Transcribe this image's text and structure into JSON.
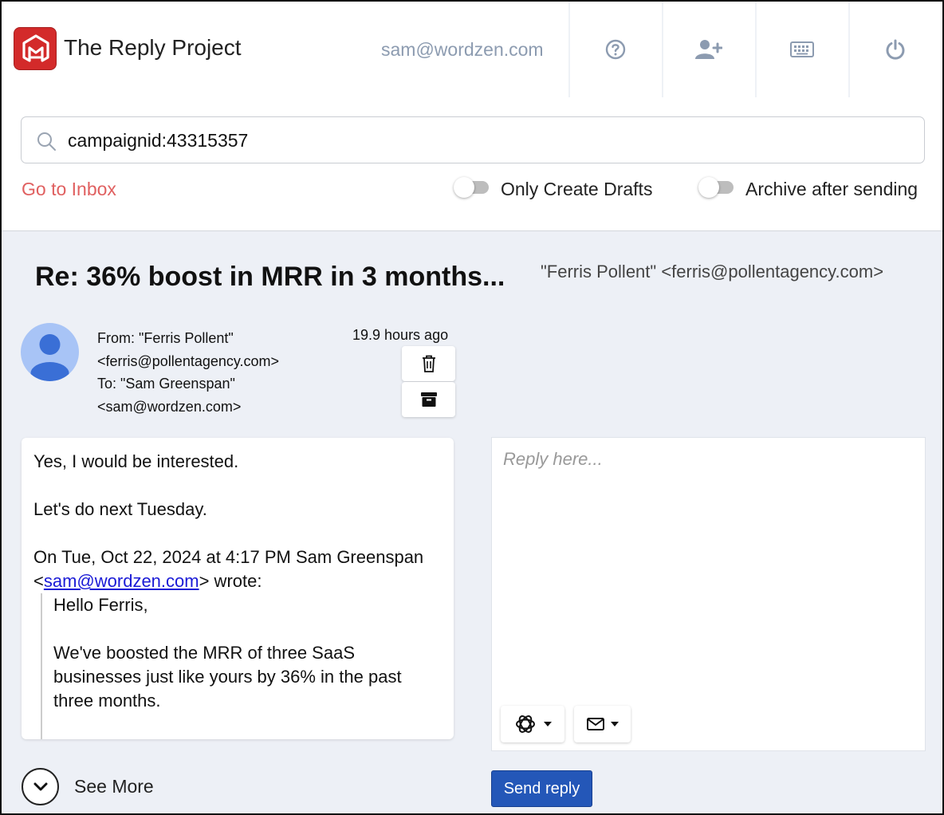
{
  "app": {
    "title": "The Reply Project",
    "account_email": "sam@wordzen.com",
    "brand_color": "#d32a2a"
  },
  "header_buttons": [
    {
      "name": "help-icon"
    },
    {
      "name": "add-user-icon"
    },
    {
      "name": "keyboard-icon"
    },
    {
      "name": "power-icon"
    }
  ],
  "search": {
    "value": "campaignid:43315357",
    "icon": "search-icon"
  },
  "controls": {
    "go_to_inbox": "Go to Inbox",
    "only_create_drafts": "Only Create Drafts",
    "only_create_drafts_on": false,
    "archive_after_sending": "Archive after sending",
    "archive_after_sending_on": false
  },
  "message": {
    "subject": "Re: 36% boost in MRR in 3 months...",
    "subject_from": "\"Ferris Pollent\" <ferris@pollentagency.com>",
    "from_line1": "From: \"Ferris Pollent\"",
    "from_line2": "<ferris@pollentagency.com>",
    "to_line1": "To: \"Sam Greenspan\"",
    "to_line2": "<sam@wordzen.com>",
    "time": "19.9 hours ago",
    "body_line1": "Yes, I would be interested.",
    "body_line2": "Let's do next Tuesday.",
    "quote_intro_before": "On Tue, Oct 22, 2024 at 4:17 PM Sam Greenspan <",
    "quote_link": "sam@wordzen.com",
    "quote_intro_after": "> wrote:",
    "quote_para1": "Hello Ferris,",
    "quote_para2": "We've boosted the MRR of three SaaS businesses just like yours by 36% in the past three months."
  },
  "see_more": "See More",
  "reply": {
    "placeholder": "Reply here...",
    "send_label": "Send reply",
    "send_color": "#2457b8"
  }
}
